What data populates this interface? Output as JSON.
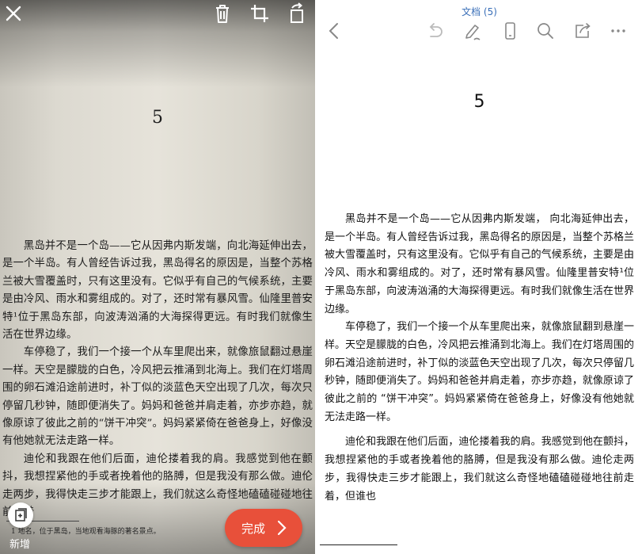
{
  "scan": {
    "page_number": "5",
    "paragraphs": [
      "黑岛并不是一个岛——它从因弗内斯发端，向北海延伸出去，是一个半岛。有人曾经告诉过我，黑岛得名的原因是，当整个苏格兰被大雪覆盖时，只有这里没有。它似乎有自己的气候系统，主要是由冷风、雨水和雾组成的。对了，还时常有暴风雪。仙隆里普安特¹位于黑岛东部，向波涛汹涌的大海探得更远。有时我们就像生活在世界边缘。",
      "车停稳了，我们一个接一个从车里爬出来，就像旅鼠翻过悬崖一样。天空是朦胧的白色，冷风把云推涌到北海上。我们在灯塔周围的卵石滩沿途前进时，补丁似的淡蓝色天空出现了几次，每次只停留几秒钟，随即便消失了。妈妈和爸爸并肩走着，亦步亦趋，就像原谅了彼此之前的“饼干冲突”。妈妈紧紧倚在爸爸身上，好像没有他她就无法走路一样。",
      "迪伦和我跟在他们后面，迪伦搂着我的肩。我感觉到他在颤抖，我想捏紧他的手或者挽着他的胳膊，但是我没有那么做。迪伦走两步，我得快走三步才能跟上，我们就这么奇怪地磕磕碰碰地往前走着"
    ],
    "footnote": "1 地名，位于黑岛，当地观看海豚的著名景点。",
    "add_label": "新增",
    "done_label": "完成"
  },
  "document": {
    "title": "文档 (5)",
    "page_number": "5",
    "paragraphs": [
      "黑岛并不是一个岛——它从因弗内斯发端， 向北海延伸出去，是一个半岛。有人曾经告诉过我，黑岛得名的原因是，当整个苏格兰被大雪覆盖时，只有这里没有。它似乎有自己的气候系统，主要是由冷风、雨水和雾组成的。对了，还时常有暴风雪。仙隆里普安特¹位于黑岛东部，向波涛汹涌的大海探得更远。有时我们就像生活在世界边缘。",
      "车停稳了，我们一个接一个从车里爬出来，就像旅鼠翻到悬崖一样。天空是朦胧的白色，冷风把云推涌到北海上。我们在灯塔周围的卵石滩沿途前进时，补丁似的淡蓝色天空出现了几次，每次只停留几秒钟，随即便消失了。妈妈和爸爸并肩走着，亦步亦趋，就像原谅了彼此之前的 “饼干冲突”。妈妈紧紧倚在爸爸身上，好像没有他她就无法走路一样。",
      "迪伦和我跟在他们后面，迪伦搂着我的肩。我感觉到他在颤抖，我想捏紧他的手或者挽着他的胳膊，但是我没有那么做。迪伦走两步，我得快走三步才能跟上，我们就这么奇怪地磕磕碰碰地往前走着，但谁也"
    ]
  },
  "icons": {
    "close": "close-icon",
    "delete": "trash-icon",
    "crop": "crop-icon",
    "rotate": "rotate-icon",
    "add_page": "add-page-icon",
    "done_arrow": "chevron-right-icon",
    "back": "chevron-left-icon",
    "undo": "undo-icon",
    "pen": "pen-icon",
    "phone_view": "phone-icon",
    "search": "search-icon",
    "share": "share-icon",
    "more": "more-icon"
  },
  "colors": {
    "accent": "#e8503a",
    "title_blue": "#3a6fb8",
    "toolbar_icon": "#888888"
  }
}
